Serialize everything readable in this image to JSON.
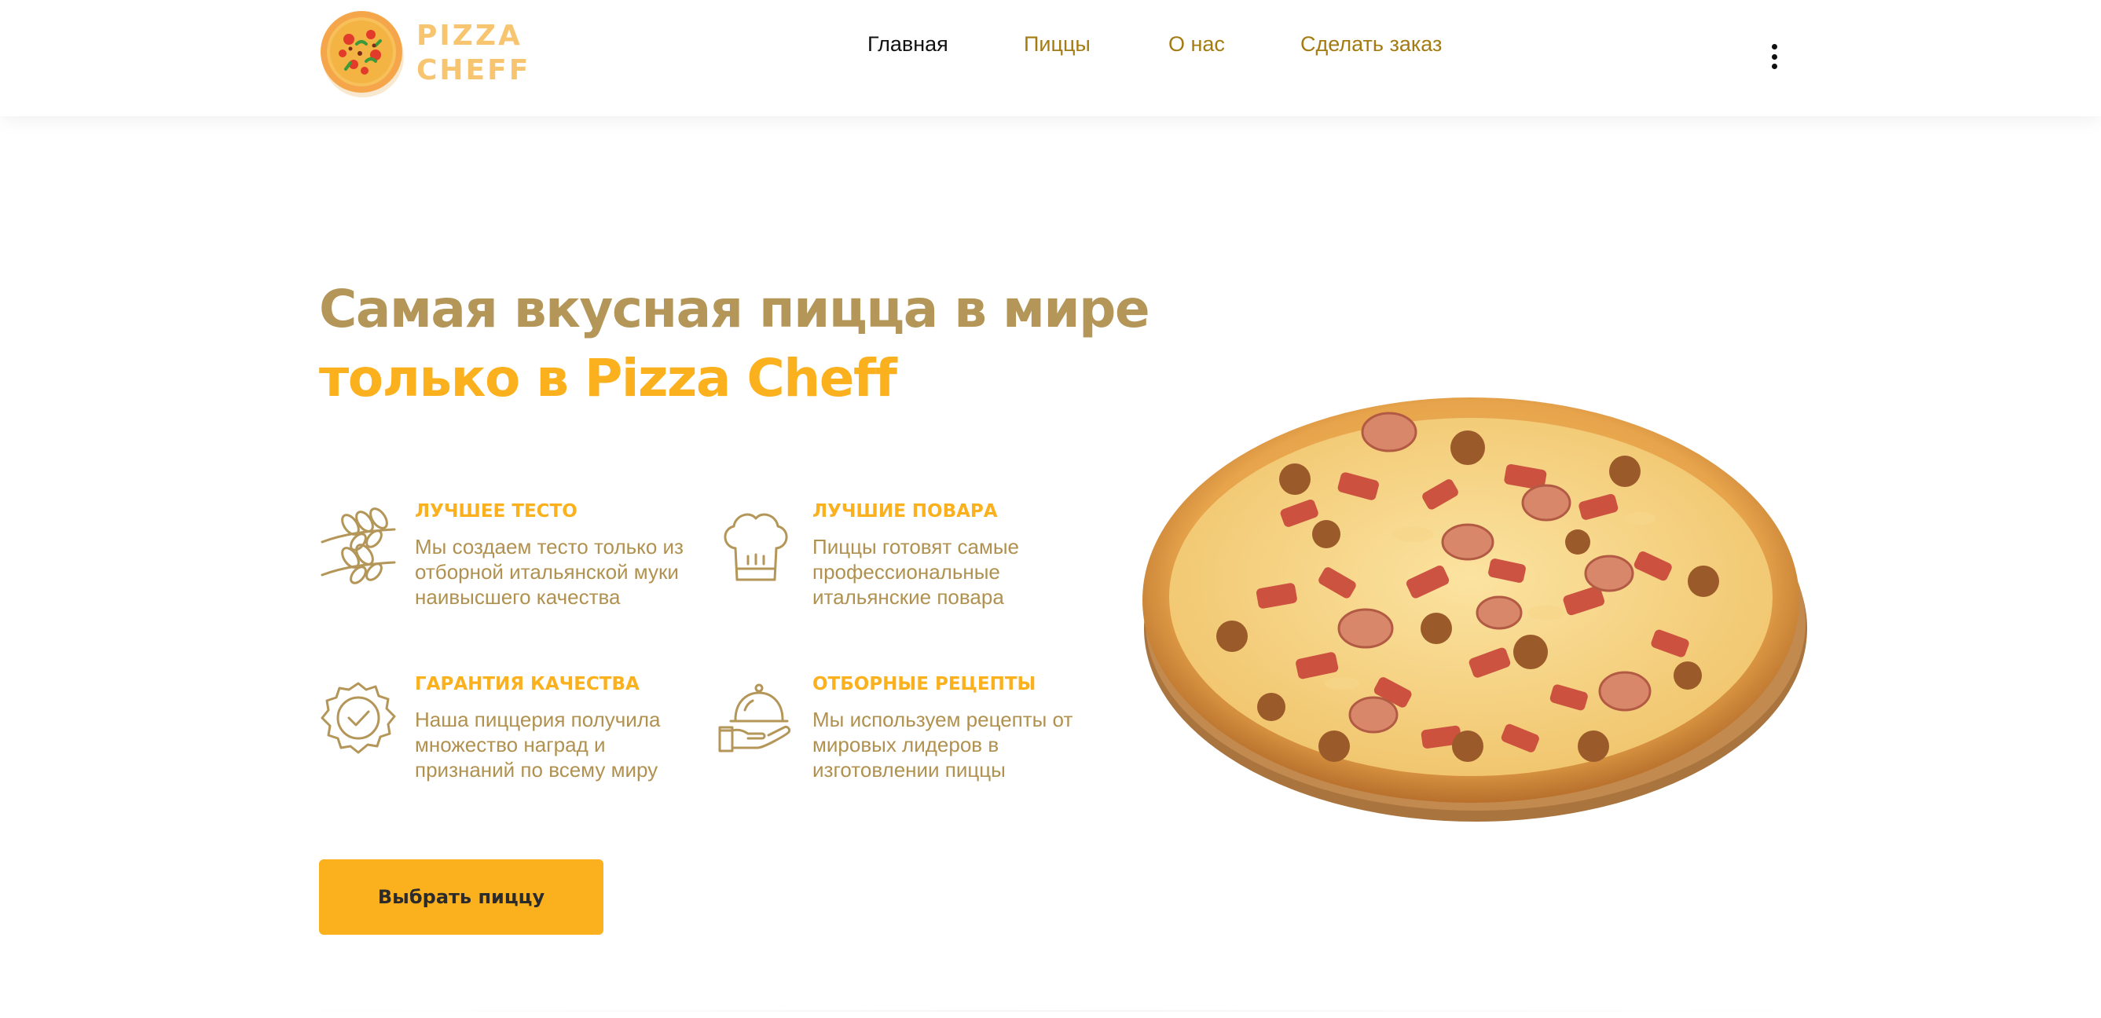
{
  "brand": {
    "logo_text_line1": "PIZZA",
    "logo_text_line2": "CHEFF",
    "logo_color": "#f7c56f"
  },
  "nav": {
    "items": [
      {
        "label": "Главная",
        "active": true
      },
      {
        "label": "Пиццы",
        "active": false
      },
      {
        "label": "О нас",
        "active": false
      },
      {
        "label": "Сделать заказ",
        "active": false
      }
    ],
    "menu_icon": "kebab-menu-icon"
  },
  "hero": {
    "title_line1": "Самая вкусная пицца в мире",
    "title_line2": "только в Pizza Cheff",
    "features": [
      {
        "icon": "wheat-icon",
        "title": "ЛУЧШЕЕ ТЕСТО",
        "description": "Мы создаем тесто только из отборной итальянской муки наивысшего качества"
      },
      {
        "icon": "chef-hat-icon",
        "title": "ЛУЧШИЕ ПОВАРА",
        "description": "Пиццы готовят самые профессиональные итальянские повара"
      },
      {
        "icon": "quality-badge-icon",
        "title": "ГАРАНТИЯ КАЧЕСТВА",
        "description": "Наша пиццерия получила множество наград и признаний по всему миру"
      },
      {
        "icon": "cloche-icon",
        "title": "ОТБОРНЫЕ РЕЦЕПТЫ",
        "description": "Мы используем рецепты от мировых лидеров в изготовлении пиццы"
      }
    ],
    "cta_label": "Выбрать пиццу"
  },
  "colors": {
    "accent": "#fbb01d",
    "heading_brown": "#b39658",
    "nav_link": "#a47b10",
    "body_text": "#b0914f"
  }
}
